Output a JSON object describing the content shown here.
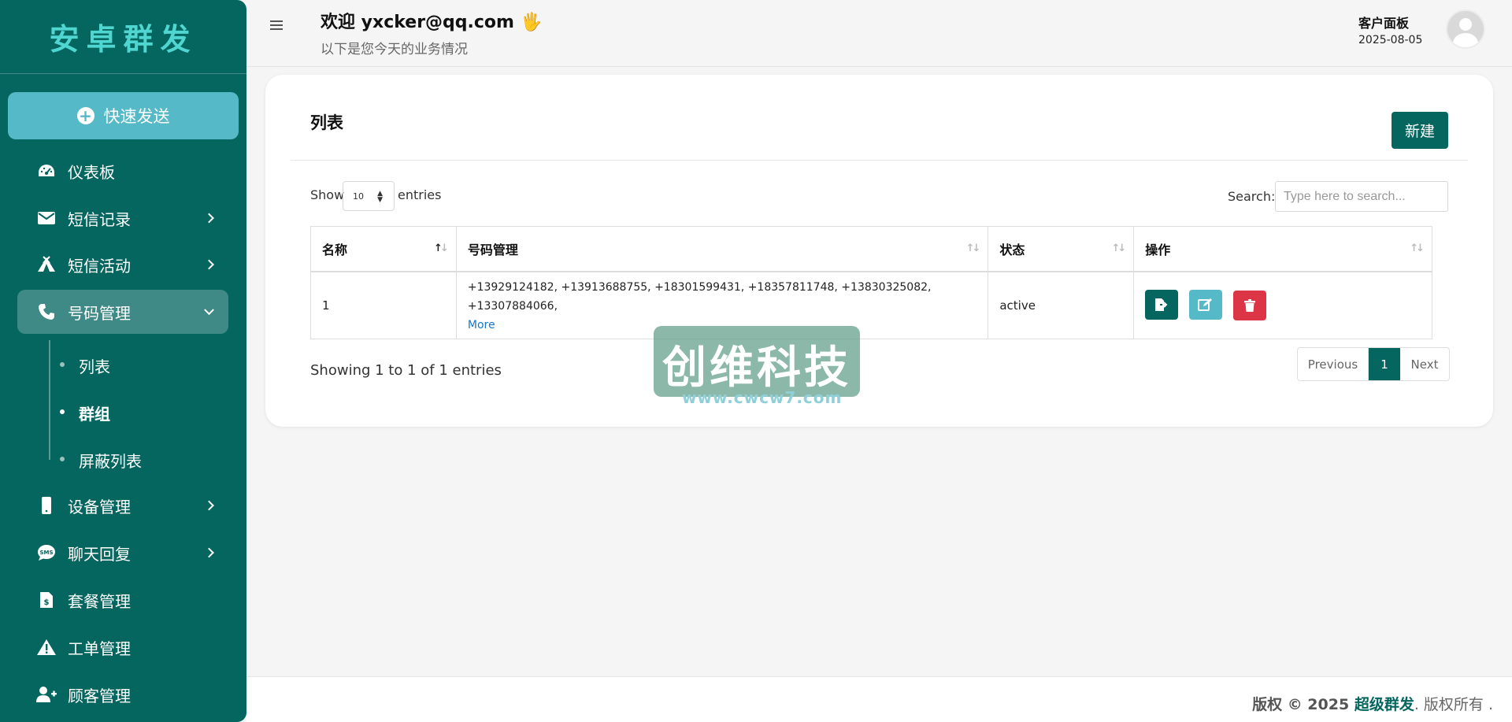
{
  "sidebar": {
    "brand": "安卓群发",
    "quick_send": "快速发送",
    "items": [
      {
        "label": "仪表板"
      },
      {
        "label": "短信记录"
      },
      {
        "label": "短信活动"
      },
      {
        "label": "号码管理"
      },
      {
        "label": "设备管理"
      },
      {
        "label": "聊天回复"
      },
      {
        "label": "套餐管理"
      },
      {
        "label": "工单管理"
      },
      {
        "label": "顾客管理"
      }
    ],
    "sub_items": [
      {
        "label": "列表"
      },
      {
        "label": "群组"
      },
      {
        "label": "屏蔽列表"
      }
    ]
  },
  "header": {
    "welcome": "欢迎 yxcker@qq.com",
    "wave": "🖐",
    "subtitle": "以下是您今天的业务情况",
    "panel_title": "客户面板",
    "date": "2025-08-05"
  },
  "card": {
    "title": "列表",
    "new_button": "新建",
    "show_label": "Show",
    "show_value": "10",
    "entries_label": "entries",
    "search_label": "Search:",
    "search_placeholder": "Type here to search...",
    "columns": [
      "名称",
      "号码管理",
      "状态",
      "操作"
    ],
    "rows": [
      {
        "name": "1",
        "numbers": "+13929124182, +13913688755, +18301599431, +18357811748, +13830325082, +13307884066,",
        "more": "More",
        "status": "active"
      }
    ],
    "showing": "Showing 1 to 1 of 1 entries",
    "pagination": {
      "previous": "Previous",
      "current": "1",
      "next": "Next"
    }
  },
  "watermark": {
    "main": "创维科技",
    "url": "www.cwcw7.com"
  },
  "footer": {
    "prefix": "版权 © 2025 ",
    "brand": "超级群发",
    "suffix": ". 版权所有 ."
  },
  "colors": {
    "primary": "#05655f",
    "info": "#55b9c7",
    "danger": "#dc3545",
    "brand_text": "#4fd6d0"
  }
}
